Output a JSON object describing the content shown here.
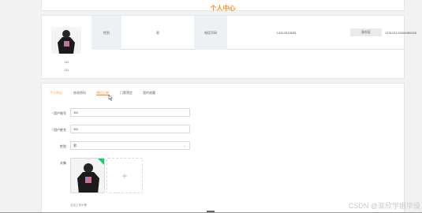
{
  "page": {
    "title": "个人中心"
  },
  "profile": {
    "username": "111",
    "fullname": "111",
    "info": {
      "gender_label": "性别",
      "gender_value": "男",
      "phone_label": "电话号码",
      "phone_value": "13513513555",
      "verify_button": "身份证",
      "id_value": "123123123456456456"
    }
  },
  "tabs": [
    "个人中心",
    "修改密码",
    "预约订单",
    "门票预定",
    "我的收藏"
  ],
  "form": {
    "account_label": "用户账号",
    "account_value": "111",
    "name_label": "用户姓名",
    "name_value": "111",
    "gender_label": "性别",
    "gender_value": "男",
    "avatar_label": "头像",
    "upload_hint": "点击上传头像"
  },
  "watermark": "CSDN @亚欣学姐毕设"
}
